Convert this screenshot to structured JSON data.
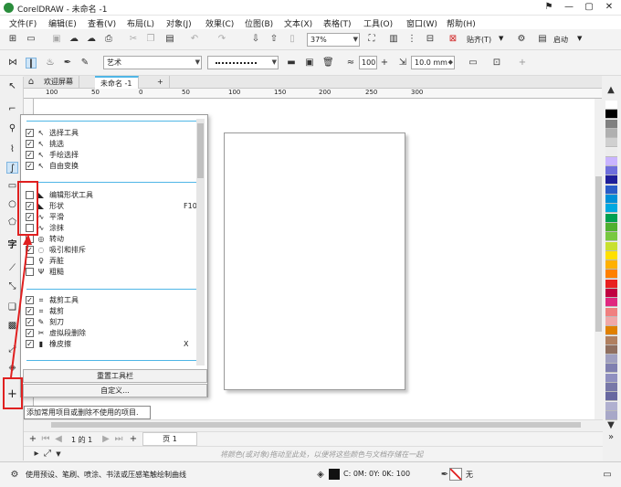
{
  "window": {
    "title": "CorelDRAW - 未命名 -1",
    "minimize": "—",
    "restore": "▢",
    "close": "✕"
  },
  "menu": [
    "文件(F)",
    "编辑(E)",
    "查看(V)",
    "布局(L)",
    "对象(J)",
    "效果(C)",
    "位图(B)",
    "文本(X)",
    "表格(T)",
    "工具(O)",
    "窗口(W)",
    "帮助(H)"
  ],
  "toolbar1": {
    "zoom": "37%",
    "paste_label": "贴齐(T)",
    "launch_label": "启动"
  },
  "toolbar2": {
    "stroke_style": "艺术",
    "size_value": "100",
    "width_value": "10.0 mm"
  },
  "tabs": {
    "welcome": "欢迎屏幕",
    "document": "未命名 -1",
    "add": "+"
  },
  "ruler": {
    "ticks": [
      "100",
      "50",
      "0",
      "50",
      "100",
      "150",
      "200",
      "250",
      "300"
    ]
  },
  "popup": {
    "groups": [
      {
        "items": [
          {
            "label": "选择工具",
            "checked": true,
            "glyph": "↖"
          },
          {
            "label": "挑选",
            "checked": true,
            "glyph": "↖"
          },
          {
            "label": "手绘选择",
            "checked": true,
            "glyph": "↖"
          },
          {
            "label": "自由变换",
            "checked": true,
            "glyph": "↖"
          }
        ]
      },
      {
        "items": [
          {
            "label": "编辑形状工具",
            "checked": false,
            "glyph": "◣"
          },
          {
            "label": "形状",
            "checked": true,
            "glyph": "◣",
            "shortcut": "F10"
          },
          {
            "label": "平滑",
            "checked": true,
            "glyph": "∿"
          },
          {
            "label": "涂抹",
            "checked": false,
            "glyph": "∿"
          },
          {
            "label": "转动",
            "checked": false,
            "glyph": "◎"
          },
          {
            "label": "吸引和排斥",
            "checked": true,
            "glyph": "◌"
          },
          {
            "label": "弄脏",
            "checked": false,
            "glyph": "♀"
          },
          {
            "label": "粗糙",
            "checked": false,
            "glyph": "Ψ"
          }
        ]
      },
      {
        "items": [
          {
            "label": "裁剪工具",
            "checked": true,
            "glyph": "⌗"
          },
          {
            "label": "裁剪",
            "checked": true,
            "glyph": "⌗"
          },
          {
            "label": "刻刀",
            "checked": true,
            "glyph": "✎"
          },
          {
            "label": "虚拟段删除",
            "checked": true,
            "glyph": "✂"
          },
          {
            "label": "橡皮擦",
            "checked": true,
            "glyph": "▮",
            "shortcut": "X"
          }
        ]
      }
    ],
    "reset_label": "重置工具栏",
    "customize_label": "自定义..."
  },
  "tooltip": "添加常用项目或删除不使用的项目.",
  "pagenav": {
    "page_of": "1 的 1",
    "page_tab": "页 1"
  },
  "hint": "将颜色(或对象)拖动至此处，以便将这些颜色与文档存储在一起",
  "status": {
    "message": "使用预设、笔刷、喷涂、书法或压感笔触绘制曲线",
    "cmyk": "C: 0M: 0Y: 0K: 100",
    "outline": "无"
  },
  "colors": {
    "accent": "#4fb6e6",
    "highlight_border": "#e02020",
    "palette": [
      "#ffffff",
      "#000000",
      "#808080",
      "#b0b0b0",
      "#d0d0d0",
      "#ececec",
      "#c9b4ff",
      "#6e6edc",
      "#1e1e9a",
      "#2a5cc8",
      "#0090d8",
      "#00a8e0",
      "#00a050",
      "#50b030",
      "#78c840",
      "#c8e030",
      "#ffe000",
      "#ffb000",
      "#ff8000",
      "#e82020",
      "#c00040",
      "#e02880",
      "#f08080",
      "#f0a8a8",
      "#e08000",
      "#b08060",
      "#907060",
      "#a0a0c0",
      "#8080b0",
      "#9090c0",
      "#7878a8",
      "#6868a0",
      "#b0b0d0",
      "#a8a8c8"
    ]
  }
}
